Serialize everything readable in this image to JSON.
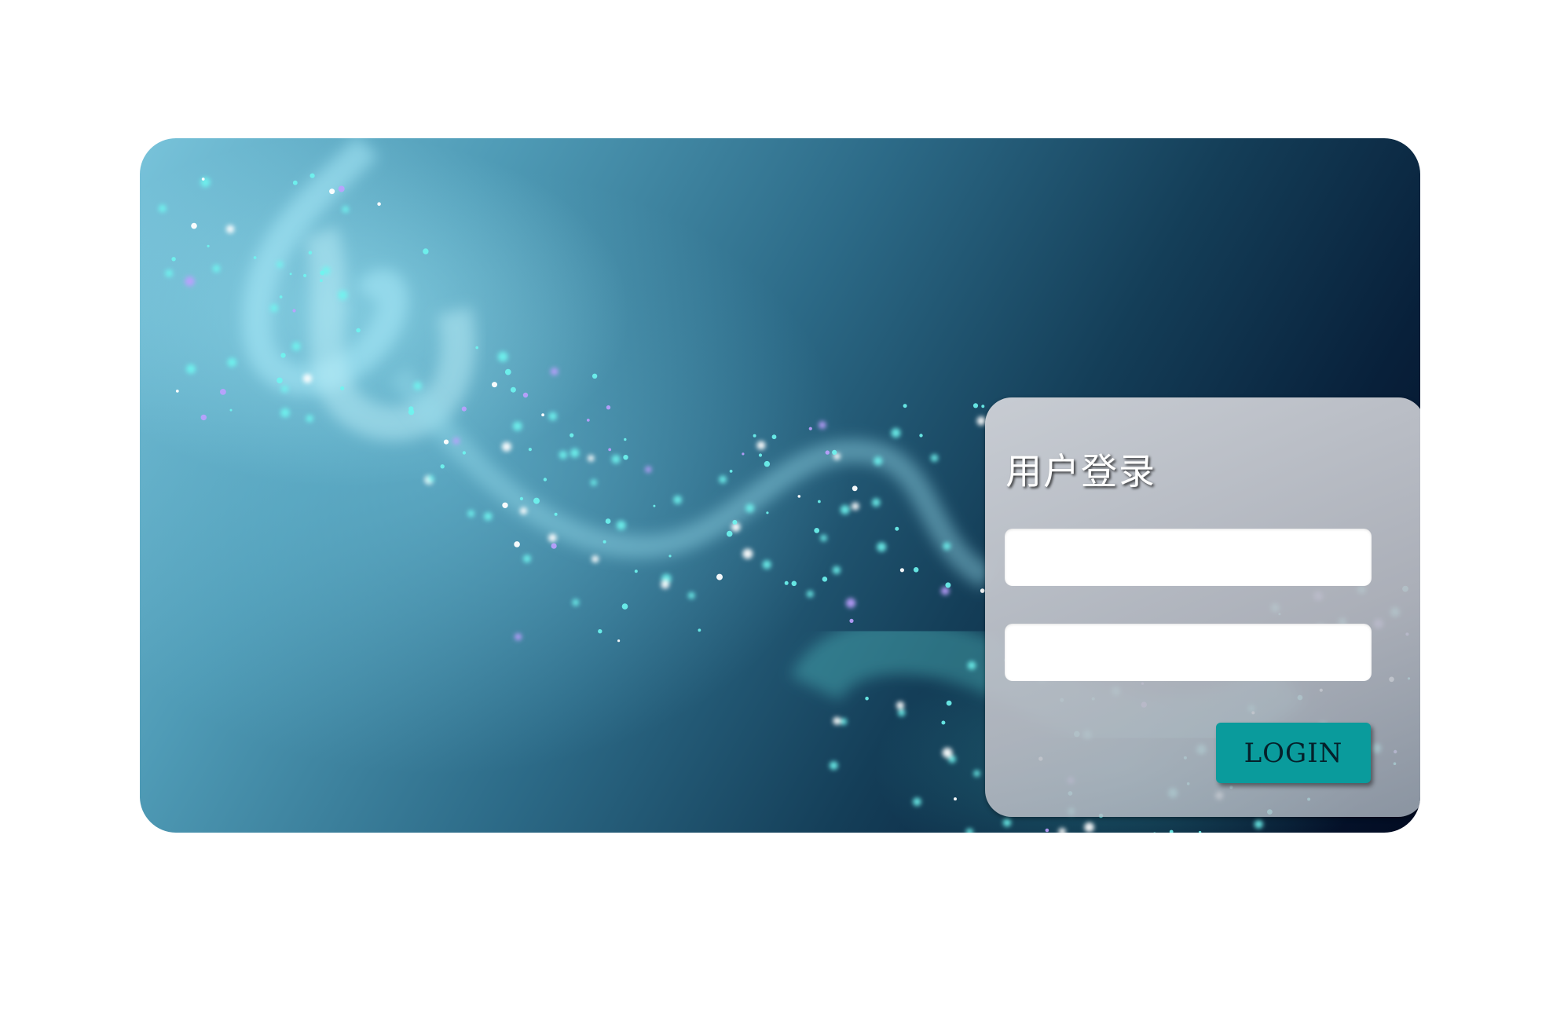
{
  "login": {
    "title": "用户登录",
    "username_value": "",
    "password_value": "",
    "submit_label": "LOGIN"
  },
  "colors": {
    "button": "#0a9b9c",
    "panel": "#c6c9cf",
    "background_light": "#78c3da",
    "background_dark": "#020b22"
  }
}
